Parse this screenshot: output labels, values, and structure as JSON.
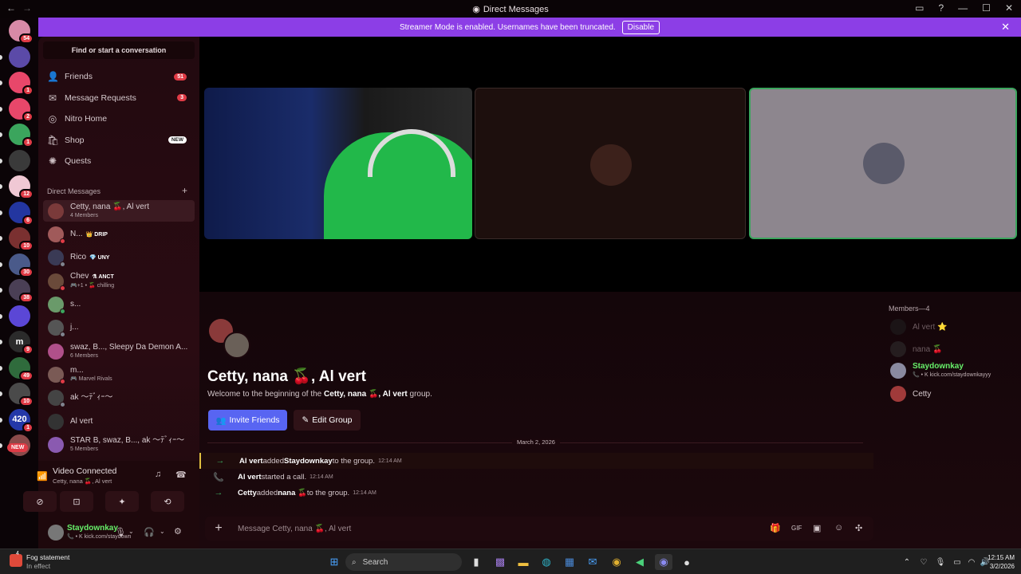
{
  "window": {
    "title": "Direct Messages",
    "nav_back": "←",
    "nav_fwd": "→",
    "controls": [
      "▭",
      "?",
      "—",
      "☐",
      "✕"
    ]
  },
  "banner": {
    "text": "Streamer Mode is enabled. Usernames have been truncated.",
    "button": "Disable",
    "close": "✕"
  },
  "rail": {
    "servers": [
      {
        "label": "",
        "badge": "54",
        "color": "#d88aa7"
      },
      {
        "label": "",
        "badge": "",
        "color": "#5b4aa8"
      },
      {
        "label": "",
        "badge": "1",
        "color": "#e8476a"
      },
      {
        "label": "",
        "badge": "2",
        "color": "#e8476a"
      },
      {
        "label": "",
        "badge": "1",
        "color": "#3ba55d"
      },
      {
        "label": "",
        "badge": "",
        "color": "#3a3a3a"
      },
      {
        "label": "",
        "badge": "12",
        "color": "#f0c8d4"
      },
      {
        "label": "",
        "badge": "6",
        "color": "#2336a0"
      },
      {
        "label": "",
        "badge": "10",
        "color": "#7a3030"
      },
      {
        "label": "",
        "badge": "30",
        "color": "#4a5a8a"
      },
      {
        "label": "",
        "badge": "38",
        "color": "#4a3f55"
      },
      {
        "label": "",
        "badge": "",
        "color": "#5b47d6"
      },
      {
        "label": "m",
        "badge": "9",
        "color": "#2b2b2b"
      },
      {
        "label": "",
        "badge": "49",
        "color": "#2f6b3c"
      },
      {
        "label": "",
        "badge": "10",
        "color": "#4a4a4a"
      },
      {
        "label": "420",
        "badge": "1",
        "color": "#2438a8"
      },
      {
        "label": "",
        "badge": "",
        "color": "#8a4a4a"
      }
    ],
    "new_badge": "NEW"
  },
  "sidebar": {
    "find_label": "Find or start a conversation",
    "nav": [
      {
        "icon": "friends-icon",
        "glyph": "👤",
        "label": "Friends",
        "count": "51"
      },
      {
        "icon": "envelope-icon",
        "glyph": "✉",
        "label": "Message Requests",
        "count": "3"
      },
      {
        "icon": "nitro-icon",
        "glyph": "◎",
        "label": "Nitro Home",
        "count": ""
      },
      {
        "icon": "shop-icon",
        "glyph": "🛍",
        "label": "Shop",
        "new": "NEW"
      },
      {
        "icon": "quests-icon",
        "glyph": "✺",
        "label": "Quests",
        "count": ""
      }
    ],
    "dm_header": "Direct Messages",
    "dm_add": "+",
    "dms": [
      {
        "name": "Cetty, nana 🍒, Al vert",
        "sub": "4 Members",
        "color": "#7a3a3a",
        "status": ""
      },
      {
        "name": "N...",
        "tag": "👑 DRIP",
        "sub": "",
        "color": "#a05a5a",
        "status": "#e03b46"
      },
      {
        "name": "Rico",
        "tag": "💎 UNY",
        "sub": "",
        "color": "#3a3a55",
        "status": "#80848e"
      },
      {
        "name": "Chev",
        "tag": "⚗ ANCT",
        "sub": "🎮+1 • 🍒 chilling",
        "color": "#6a4a3a",
        "status": "#e03b46"
      },
      {
        "name": "s...",
        "sub": "",
        "color": "#6a9a6a",
        "status": "#3ba55d"
      },
      {
        "name": "j...",
        "sub": "",
        "color": "#555",
        "status": "#80848e"
      },
      {
        "name": "swaz, B..., Sleepy Da Demon A...",
        "sub": "6 Members",
        "color": "#b0508a",
        "status": ""
      },
      {
        "name": "m...",
        "sub": "🎮 Marvel Rivals",
        "color": "#7a5a55",
        "status": "#e03b46"
      },
      {
        "name": "ak ～ﾃﾞｨｰ～",
        "sub": "",
        "color": "#444",
        "status": "#80848e"
      },
      {
        "name": "Al vert",
        "sub": "",
        "color": "#333",
        "status": ""
      },
      {
        "name": "STAR B, swaz, B..., ak ～ﾃﾞｨｰ～",
        "sub": "5 Members",
        "color": "#8a5ab0",
        "status": ""
      }
    ]
  },
  "voice": {
    "title": "Video Connected",
    "sub": "Cetty, nana 🍒, Al vert",
    "buttons": [
      "⊘",
      "⊡",
      "✦",
      "⟲"
    ]
  },
  "user": {
    "name": "Staydownkay",
    "sub": "📞 • K kick.com/staydown"
  },
  "main": {
    "members_header": "Members—4",
    "members": [
      {
        "name": "Al vert",
        "extra": "⭐",
        "dim": true,
        "color": "#222",
        "sub": ""
      },
      {
        "name": "nana",
        "extra": "🍒",
        "dim": true,
        "color": "#333",
        "sub": ""
      },
      {
        "name": "Staydownkay",
        "extra": "",
        "dim": false,
        "color": "#8a8aa0",
        "sub": "📞 • K kick.com/staydownkayyy",
        "green": true
      },
      {
        "name": "Cetty",
        "extra": "",
        "dim": false,
        "color": "#a03a3a",
        "sub": ""
      }
    ],
    "title": "Cetty, nana 🍒, Al vert",
    "welcome_pre": "Welcome to the beginning of the ",
    "welcome_bold": "Cetty, nana 🍒, Al vert",
    "welcome_post": " group.",
    "invite": "Invite Friends",
    "edit": "Edit Group",
    "date": "March 2, 2026",
    "messages": [
      {
        "icon": "→",
        "actor": "Al vert",
        "mid": " added ",
        "target": "Staydownkay",
        "tail": " to the group.",
        "time": "12:14 AM"
      },
      {
        "icon": "📞",
        "actor": "Al vert",
        "mid": " started a call.",
        "target": "",
        "tail": "",
        "time": "12:14 AM"
      },
      {
        "icon": "→",
        "actor": "Cetty",
        "mid": " added ",
        "target": "nana 🍒",
        "tail": " to the group.",
        "time": "12:14 AM"
      }
    ],
    "composer_placeholder": "Message Cetty, nana 🍒, Al vert"
  },
  "taskbar": {
    "weather_title": "Fog statement",
    "weather_sub": "In effect",
    "weather_badge": "4",
    "search": "Search",
    "time": "12:15 AM",
    "date": "3/2/2026"
  }
}
